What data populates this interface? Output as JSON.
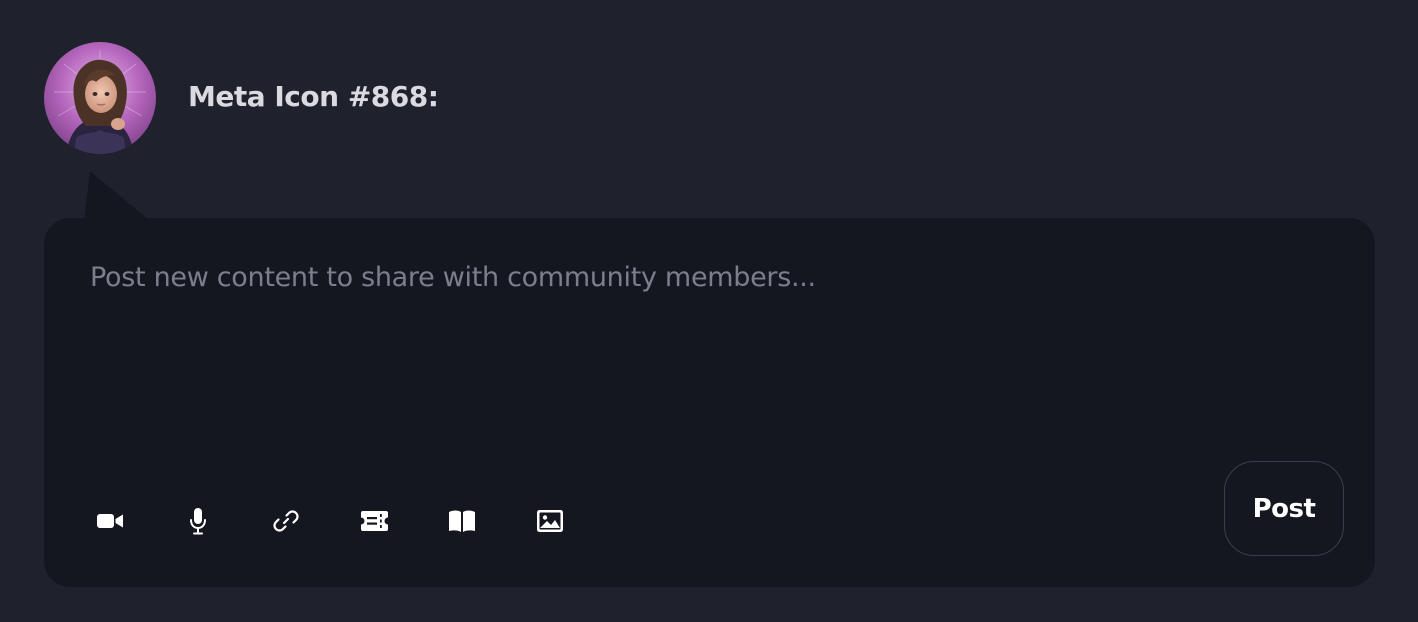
{
  "user": {
    "name": "Meta Icon #868:"
  },
  "composer": {
    "placeholder": "Post new content to share with community members...",
    "value": ""
  },
  "toolbar": {
    "items": [
      {
        "icon": "video-camera-icon"
      },
      {
        "icon": "microphone-icon"
      },
      {
        "icon": "link-icon"
      },
      {
        "icon": "ticket-icon"
      },
      {
        "icon": "book-icon"
      },
      {
        "icon": "image-icon"
      }
    ]
  },
  "actions": {
    "post_label": "Post"
  },
  "colors": {
    "background": "#1f222d",
    "composer_background": "#151720",
    "text": "#d9dbe0",
    "placeholder": "#7c7f89",
    "icon": "#ffffff",
    "button_border": "#3b3e48",
    "avatar_accent": "#b05fb8"
  }
}
